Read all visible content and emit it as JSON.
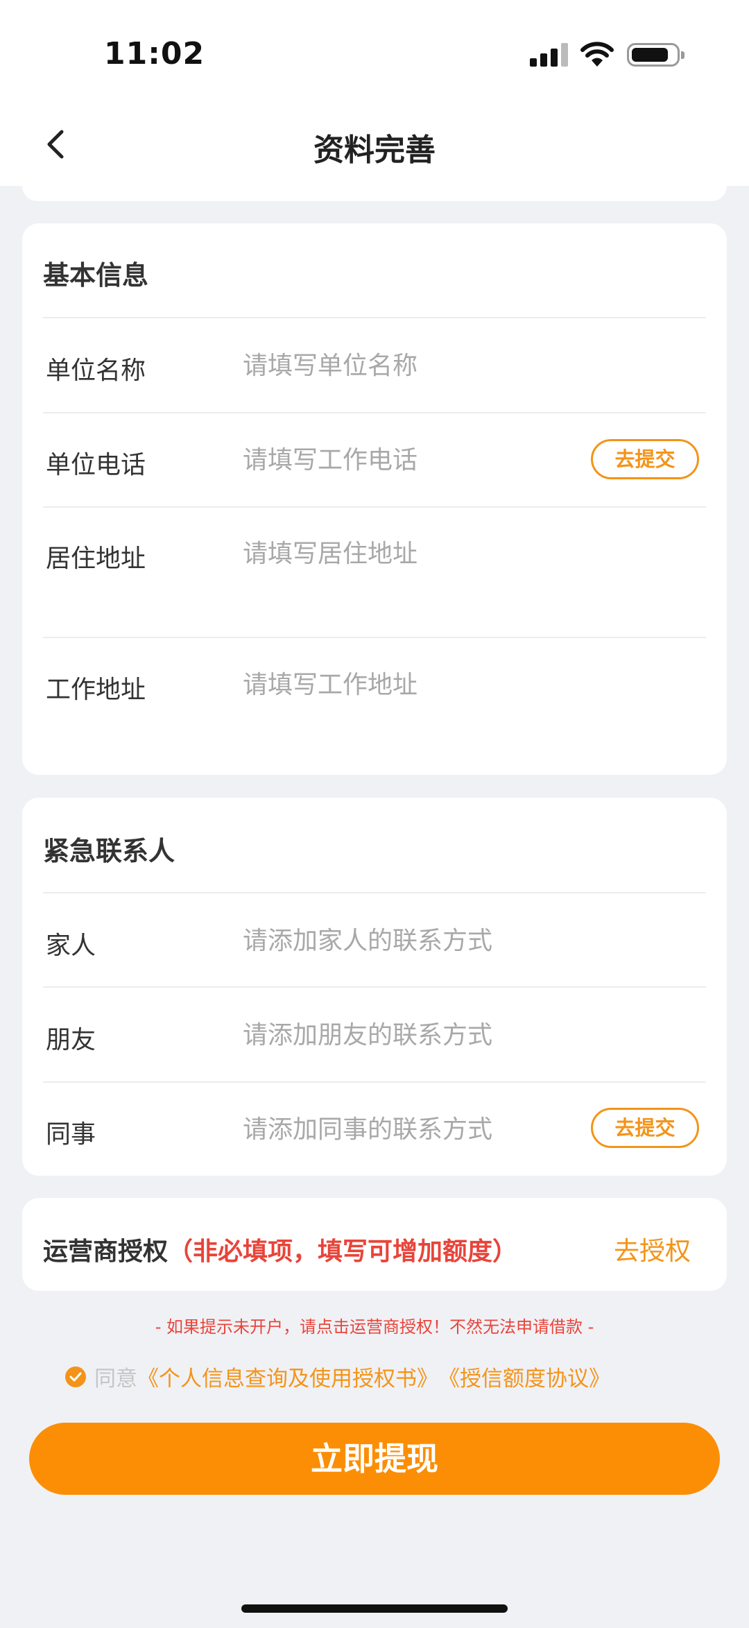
{
  "status_bar": {
    "time": "11:02"
  },
  "nav": {
    "title": "资料完善"
  },
  "basic_info": {
    "title": "基本信息",
    "rows": [
      {
        "label": "单位名称",
        "placeholder": "请填写单位名称"
      },
      {
        "label": "单位电话",
        "placeholder": "请填写工作电话",
        "action": "去提交"
      },
      {
        "label": "居住地址",
        "placeholder": "请填写居住地址"
      },
      {
        "label": "工作地址",
        "placeholder": "请填写工作地址"
      }
    ]
  },
  "emergency_contacts": {
    "title": "紧急联系人",
    "rows": [
      {
        "label": "家人",
        "placeholder": "请添加家人的联系方式"
      },
      {
        "label": "朋友",
        "placeholder": "请添加朋友的联系方式"
      },
      {
        "label": "同事",
        "placeholder": "请添加同事的联系方式",
        "action": "去提交"
      }
    ]
  },
  "carrier_auth": {
    "title": "运营商授权",
    "note": "（非必填项，填写可增加额度）",
    "action": "去授权"
  },
  "notice": "- 如果提示未开户，请点击运营商授权！不然无法申请借款 -",
  "agreement": {
    "prefix": "同意",
    "link1": "《个人信息查询及使用授权书》",
    "link2": "《授信额度协议》"
  },
  "submit_label": "立即提现",
  "colors": {
    "accent": "#fc8e05",
    "warning": "#e8443a",
    "background": "#f0f1f5"
  }
}
